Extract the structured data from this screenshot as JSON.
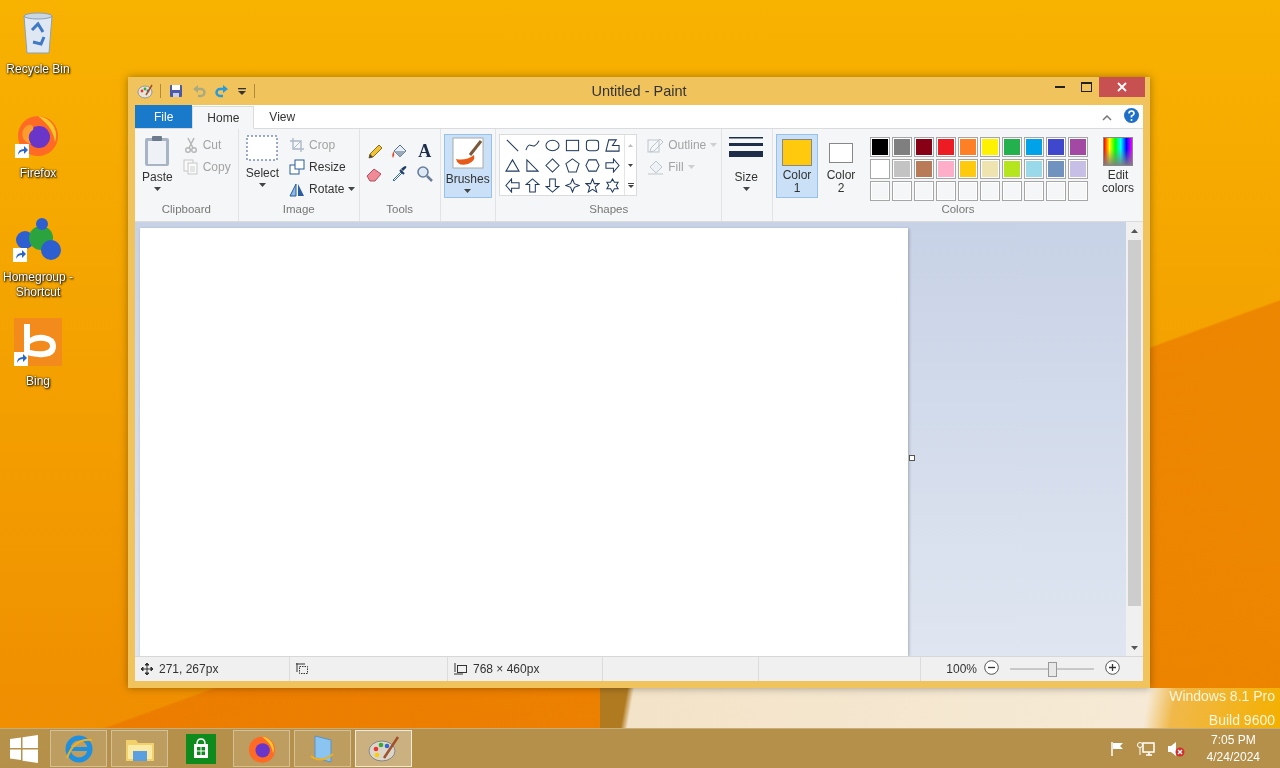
{
  "desktop_icons": [
    {
      "label": "Recycle Bin",
      "kind": "bin",
      "shortcut": false
    },
    {
      "label": "Firefox",
      "kind": "firefox",
      "shortcut": true
    },
    {
      "label": "Homegroup - Shortcut",
      "kind": "homegroup",
      "shortcut": true
    },
    {
      "label": "Bing",
      "kind": "bing",
      "shortcut": true
    }
  ],
  "window": {
    "title": "Untitled - Paint",
    "quick_access": [
      {
        "kind": "save",
        "disabled": false
      },
      {
        "kind": "undo",
        "disabled": true
      },
      {
        "kind": "redo",
        "disabled": false
      },
      {
        "kind": "customize",
        "disabled": false
      }
    ],
    "tabs": [
      {
        "label": "File",
        "kind": "file",
        "selected": false
      },
      {
        "label": "Home",
        "kind": "tab",
        "selected": true
      },
      {
        "label": "View",
        "kind": "tab",
        "selected": false
      }
    ],
    "ribbon": {
      "clipboard": {
        "label": "Clipboard",
        "paste": "Paste",
        "small": [
          {
            "label": "Cut",
            "kind": "scissors",
            "disabled": true
          },
          {
            "label": "Copy",
            "kind": "copy",
            "disabled": true
          }
        ]
      },
      "image": {
        "label": "Image",
        "select": "Select",
        "small": [
          {
            "label": "Crop",
            "kind": "crop",
            "disabled": true,
            "dropdown": false
          },
          {
            "label": "Resize",
            "kind": "resize",
            "disabled": false,
            "dropdown": false
          },
          {
            "label": "Rotate",
            "kind": "rotate",
            "disabled": false,
            "dropdown": true
          }
        ]
      },
      "tools": {
        "label": "Tools",
        "items": [
          {
            "kind": "pencil"
          },
          {
            "kind": "fill"
          },
          {
            "kind": "text",
            "glyph": "A"
          },
          {
            "kind": "eraser"
          },
          {
            "kind": "picker"
          },
          {
            "kind": "magnifier"
          }
        ]
      },
      "brushes": {
        "label": "Brushes",
        "selected": true
      },
      "shapes": {
        "label": "Shapes",
        "items": [
          {
            "kind": "line"
          },
          {
            "kind": "curve"
          },
          {
            "kind": "oval"
          },
          {
            "kind": "rectangle"
          },
          {
            "kind": "rounded"
          },
          {
            "kind": "polygon"
          },
          {
            "kind": "triangle"
          },
          {
            "kind": "right-triangle"
          },
          {
            "kind": "diamond"
          },
          {
            "kind": "pentagon"
          },
          {
            "kind": "hexagon"
          },
          {
            "kind": "right-arrow"
          },
          {
            "kind": "left-arrow"
          },
          {
            "kind": "up-arrow"
          },
          {
            "kind": "down-arrow"
          },
          {
            "kind": "star4"
          },
          {
            "kind": "star5"
          },
          {
            "kind": "star6"
          }
        ],
        "outline": {
          "label": "Outline",
          "disabled": true
        },
        "fill": {
          "label": "Fill",
          "disabled": true
        }
      },
      "size": {
        "label": "Size"
      },
      "colors": {
        "label": "Colors",
        "color1": {
          "label": "Color 1",
          "color": "#ffc90e",
          "selected": true
        },
        "color2": {
          "label": "Color 2",
          "color": "#ffffff",
          "selected": false
        },
        "palette": [
          {
            "kind": "swatch",
            "color": "#000000"
          },
          {
            "kind": "swatch",
            "color": "#7f7f7f"
          },
          {
            "kind": "swatch",
            "color": "#880015"
          },
          {
            "kind": "swatch",
            "color": "#ed1c24"
          },
          {
            "kind": "swatch",
            "color": "#ff7f27"
          },
          {
            "kind": "swatch",
            "color": "#fff200"
          },
          {
            "kind": "swatch",
            "color": "#22b14c"
          },
          {
            "kind": "swatch",
            "color": "#00a2e8"
          },
          {
            "kind": "swatch",
            "color": "#3f48cc"
          },
          {
            "kind": "swatch",
            "color": "#a349a4"
          },
          {
            "kind": "swatch",
            "color": "#ffffff"
          },
          {
            "kind": "swatch",
            "color": "#c3c3c3"
          },
          {
            "kind": "swatch",
            "color": "#b97a57"
          },
          {
            "kind": "swatch",
            "color": "#ffaec9"
          },
          {
            "kind": "swatch",
            "color": "#ffc90e"
          },
          {
            "kind": "swatch",
            "color": "#efe4b0"
          },
          {
            "kind": "swatch",
            "color": "#b5e61d"
          },
          {
            "kind": "swatch",
            "color": "#99d9ea"
          },
          {
            "kind": "swatch",
            "color": "#7092be"
          },
          {
            "kind": "swatch",
            "color": "#c8bfe7"
          },
          {
            "kind": "empty"
          },
          {
            "kind": "empty"
          },
          {
            "kind": "empty"
          },
          {
            "kind": "empty"
          },
          {
            "kind": "empty"
          },
          {
            "kind": "empty"
          },
          {
            "kind": "empty"
          },
          {
            "kind": "empty"
          },
          {
            "kind": "empty"
          },
          {
            "kind": "empty"
          }
        ],
        "edit": "Edit colors"
      }
    },
    "status_bar": {
      "position": "271, 267px",
      "canvas_size": "768 × 460px",
      "zoom": "100%",
      "zoom_slider": {
        "level": 0.5
      }
    }
  },
  "os_watermark": [
    "Windows 8.1 Pro",
    "Build 9600"
  ],
  "taskbar": {
    "apps": [
      {
        "kind": "ie",
        "running": true,
        "selected": false
      },
      {
        "kind": "explorer",
        "running": true,
        "selected": false
      },
      {
        "kind": "store",
        "running": false,
        "selected": false
      },
      {
        "kind": "firefox",
        "running": true,
        "selected": false
      },
      {
        "kind": "document",
        "running": true,
        "selected": false
      },
      {
        "kind": "paint",
        "running": true,
        "selected": true
      }
    ],
    "tray": [
      {
        "kind": "flag"
      },
      {
        "kind": "network"
      },
      {
        "kind": "muted"
      }
    ],
    "time": "7:05 PM",
    "date": "4/24/2024"
  }
}
